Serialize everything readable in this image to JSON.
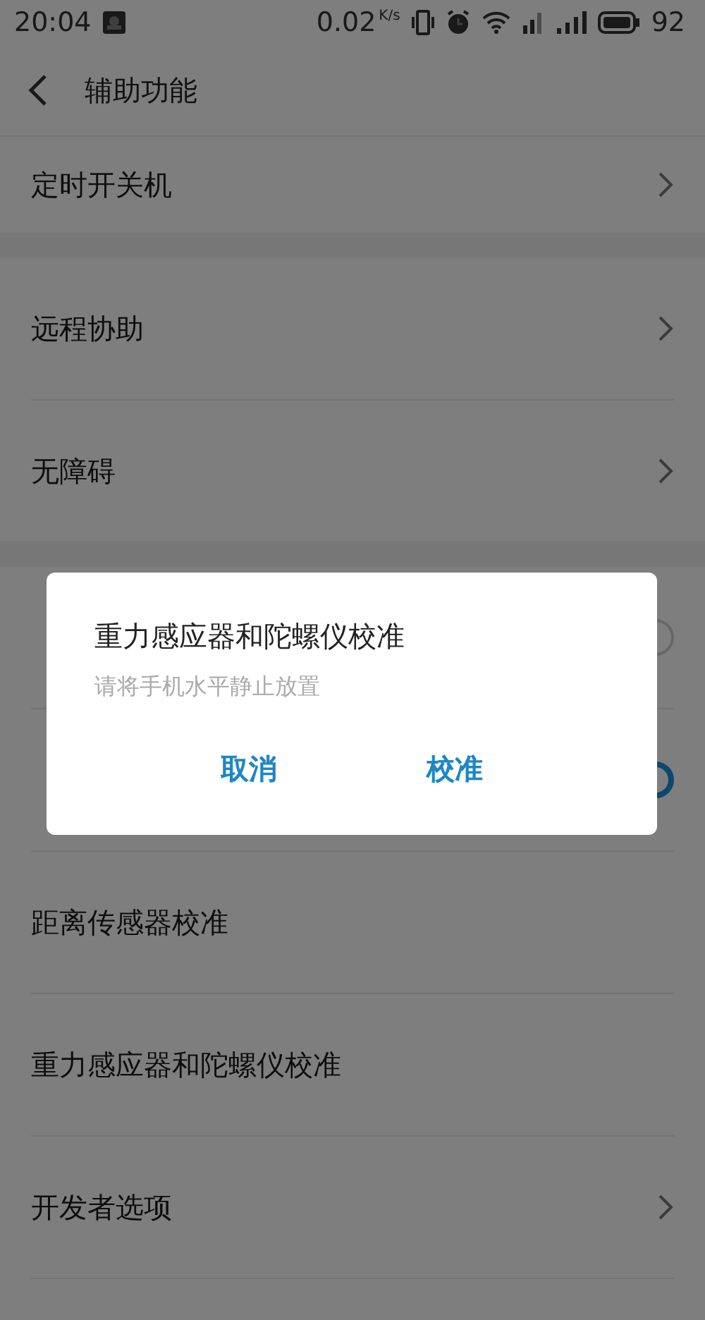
{
  "status_bar": {
    "time": "20:04",
    "speed": "0.02",
    "speed_unit": "K/s",
    "battery": "92"
  },
  "header": {
    "title": "辅助功能"
  },
  "sections": [
    {
      "items": [
        {
          "kind": "link",
          "title": "定时开关机"
        }
      ]
    },
    {
      "items": [
        {
          "kind": "link",
          "title": "远程协助"
        },
        {
          "kind": "link",
          "title": "无障碍"
        }
      ]
    },
    {
      "items": [
        {
          "kind": "toggle",
          "on": false
        },
        {
          "kind": "toggle",
          "on": true
        },
        {
          "kind": "plain",
          "title": "距离传感器校准"
        },
        {
          "kind": "plain",
          "title": "重力感应器和陀螺仪校准"
        },
        {
          "kind": "link",
          "title": "开发者选项"
        }
      ]
    }
  ],
  "dialog": {
    "title": "重力感应器和陀螺仪校准",
    "message": "请将手机水平静止放置",
    "buttons": [
      "取消",
      "校准"
    ]
  }
}
